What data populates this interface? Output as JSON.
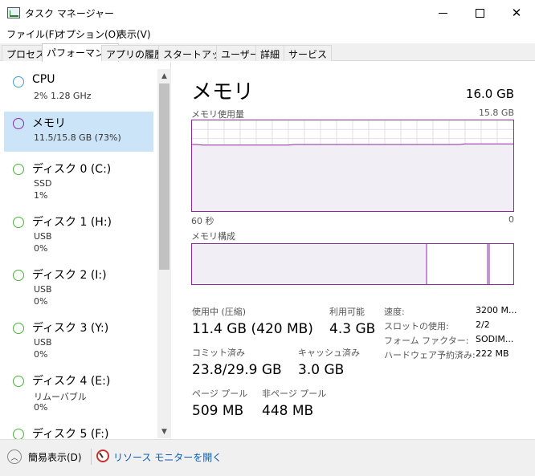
{
  "window": {
    "title": "タスク マネージャー",
    "minimize_glyph": "",
    "close_glyph": "✕"
  },
  "menu": [
    {
      "label": "ファイル(F)"
    },
    {
      "label": "オプション(O)"
    },
    {
      "label": "表示(V)"
    }
  ],
  "tabs": [
    {
      "label": "プロセス",
      "active": false
    },
    {
      "label": "パフォーマンス",
      "active": true
    },
    {
      "label": "アプリの履歴",
      "active": false
    },
    {
      "label": "スタートアップ",
      "active": false
    },
    {
      "label": "ユーザー",
      "active": false
    },
    {
      "label": "詳細",
      "active": false
    },
    {
      "label": "サービス",
      "active": false
    }
  ],
  "sidebar": {
    "items": [
      {
        "title": "CPU",
        "sub1": "2%  1.28 GHz",
        "sub2": "",
        "color": "#40a0d0",
        "selected": false
      },
      {
        "title": "メモリ",
        "sub1": "11.5/15.8 GB (73%)",
        "sub2": "",
        "color": "#8b2c9d",
        "selected": true
      },
      {
        "title": "ディスク 0 (C:)",
        "sub1": "SSD",
        "sub2": "1%",
        "color": "#4caf3f",
        "selected": false
      },
      {
        "title": "ディスク 1 (H:)",
        "sub1": "USB",
        "sub2": "0%",
        "color": "#4caf3f",
        "selected": false
      },
      {
        "title": "ディスク 2 (I:)",
        "sub1": "USB",
        "sub2": "0%",
        "color": "#4caf3f",
        "selected": false
      },
      {
        "title": "ディスク 3 (Y:)",
        "sub1": "USB",
        "sub2": "0%",
        "color": "#4caf3f",
        "selected": false
      },
      {
        "title": "ディスク 4 (E:)",
        "sub1": "リムーバブル",
        "sub2": "0%",
        "color": "#4caf3f",
        "selected": false
      },
      {
        "title": "ディスク 5 (F:)",
        "sub1": "",
        "sub2": "",
        "color": "#4caf3f",
        "selected": false
      }
    ],
    "scroll_up": "▲",
    "scroll_down": "▼"
  },
  "main": {
    "title": "メモリ",
    "total": "16.0 GB",
    "usage_graph": {
      "label": "メモリ使用量",
      "max_label": "15.8 GB",
      "x_left": "60 秒",
      "x_right": "0",
      "max_gb": 15.8,
      "series": [
        11.6,
        11.6,
        11.5,
        11.5,
        11.5,
        11.5,
        11.5,
        11.5,
        11.5,
        11.5,
        11.5,
        11.5,
        11.5,
        11.5,
        11.5,
        11.5,
        11.5,
        11.5,
        11.5,
        11.6,
        11.6,
        11.6,
        11.6,
        11.6,
        11.6,
        11.6,
        11.6,
        11.6,
        11.6,
        11.6,
        11.6,
        11.6,
        11.6,
        11.6,
        11.6,
        11.6,
        11.6,
        11.6,
        11.6,
        11.6,
        11.6,
        11.6,
        11.6,
        11.6,
        11.6,
        11.6,
        11.6,
        11.6,
        11.6,
        11.6,
        11.6,
        11.7,
        11.7,
        11.7,
        11.7,
        11.7,
        11.7,
        11.7,
        11.7,
        11.7,
        11.7
      ]
    },
    "composition": {
      "label": "メモリ構成",
      "segments": [
        {
          "fraction": 0.73,
          "color": "#f2eef5"
        },
        {
          "fraction": 0.19,
          "color": "#ffffff"
        },
        {
          "fraction": 0.005,
          "color": "#ffffff"
        },
        {
          "fraction": 0.075,
          "color": "#ffffff"
        }
      ]
    },
    "stats": {
      "in_use_label": "使用中 (圧縮)",
      "in_use_value": "11.4 GB (420 MB)",
      "available_label": "利用可能",
      "available_value": "4.3 GB",
      "committed_label": "コミット済み",
      "committed_value": "23.8/29.9 GB",
      "cached_label": "キャッシュ済み",
      "cached_value": "3.0 GB",
      "paged_label": "ページ プール",
      "paged_value": "509 MB",
      "nonpaged_label": "非ページ プール",
      "nonpaged_value": "448 MB"
    },
    "specs": [
      {
        "label": "速度:",
        "value": "3200 M..."
      },
      {
        "label": "スロットの使用:",
        "value": "2/2"
      },
      {
        "label": "フォーム ファクター:",
        "value": "SODIM..."
      },
      {
        "label": "ハードウェア予約済み:",
        "value": "222 MB"
      }
    ]
  },
  "footer": {
    "simple_view": "簡易表示(D)",
    "resource_monitor": "リソース モニターを開く",
    "collapse_glyph": "︿"
  },
  "colors": {
    "memory_accent": "#8b2c9d",
    "graph_fill": "#f2eef5",
    "grid": "#e6dcea",
    "selected_bg": "#cce4f7",
    "link": "#0a5bb5"
  }
}
